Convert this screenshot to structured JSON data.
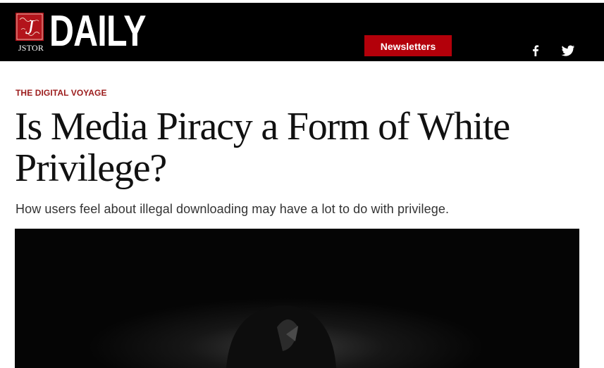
{
  "header": {
    "logo": {
      "mark_text": "J",
      "org": "JSTOR",
      "brand": "DAILY"
    },
    "newsletters_label": "Newsletters",
    "social": [
      {
        "icon": "facebook-icon",
        "glyph": "f"
      },
      {
        "icon": "twitter-icon"
      }
    ],
    "colors": {
      "bar": "#000000",
      "accent": "#b3000a"
    }
  },
  "article": {
    "kicker": "THE DIGITAL VOYAGE",
    "title": "Is Media Piracy a Form of White Privilege?",
    "dek": "How users feel about illegal downloading may have a lot to do with privilege.",
    "hero_image": "dark-hooded-figure-image",
    "colors": {
      "kicker": "#9b1b1b",
      "title": "#111111"
    }
  }
}
